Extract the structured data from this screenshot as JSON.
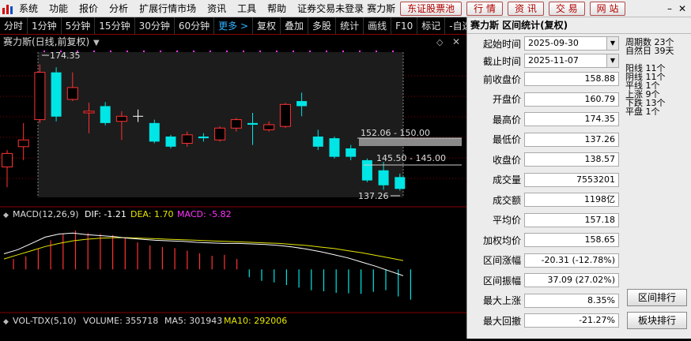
{
  "menu": {
    "items": [
      "系统",
      "功能",
      "报价",
      "分析",
      "扩展行情市场",
      "资讯",
      "工具",
      "帮助"
    ],
    "status": "证券交易未登录",
    "stock_name": "赛力斯",
    "buttons": [
      "东证股票池",
      "行 情",
      "资 讯",
      "交 易",
      "网 站"
    ]
  },
  "toolbar": {
    "items": [
      "分时",
      "1分钟",
      "5分钟",
      "15分钟",
      "30分钟",
      "60分钟"
    ],
    "more": "更多 >",
    "actions": [
      "复权",
      "叠加",
      "多股",
      "统计",
      "画线",
      "F10",
      "标记",
      "-自选"
    ]
  },
  "chart": {
    "title": "赛力斯(日线,前复权)",
    "high_label": "174.35",
    "low_label": "137.26",
    "range_labels": [
      "152.06 - 150.00",
      "145.50 - 145.00"
    ],
    "macd_label": "MACD(12,26,9)",
    "dif": "DIF: -1.21",
    "dea": "DEA: 1.70",
    "macd": "MACD: -5.82",
    "vol_label": "VOL-TDX(5,10)",
    "volume": "VOLUME: 355718",
    "ma5": "MA5: 301943",
    "ma10": "MA10: 292006",
    "colors": {
      "up": "#ff3232",
      "down": "#00e5e5",
      "dif": "#ffffff",
      "dea": "#e6e600",
      "macd": "#ff33ff",
      "grid": "#8a0000"
    }
  },
  "chart_data": {
    "type": "candlestick",
    "candles": [
      {
        "o": 144.0,
        "c": 148.0,
        "h": 149.0,
        "l": 138.0
      },
      {
        "o": 150.0,
        "c": 152.0,
        "h": 157.0,
        "l": 146.0
      },
      {
        "o": 158.0,
        "c": 172.0,
        "h": 174.35,
        "l": 157.0
      },
      {
        "o": 172.0,
        "c": 158.9,
        "h": 173.5,
        "l": 157.5
      },
      {
        "o": 164.0,
        "c": 167.5,
        "h": 172.0,
        "l": 163.5
      },
      {
        "o": 160.0,
        "c": 160.5,
        "h": 163.0,
        "l": 154.0
      },
      {
        "o": 162.0,
        "c": 157.0,
        "h": 163.2,
        "l": 156.3
      },
      {
        "o": 157.5,
        "c": 159.0,
        "h": 160.5,
        "l": 152.0
      },
      {
        "o": 159.0,
        "c": 159.0,
        "h": 161.0,
        "l": 157.3
      },
      {
        "o": 157.0,
        "c": 151.5,
        "h": 158.0,
        "l": 151.0
      },
      {
        "o": 153.0,
        "c": 150.0,
        "h": 153.5,
        "l": 149.5
      },
      {
        "o": 151.0,
        "c": 153.5,
        "h": 154.5,
        "l": 150.0
      },
      {
        "o": 153.0,
        "c": 152.5,
        "h": 154.0,
        "l": 151.5
      },
      {
        "o": 152.0,
        "c": 155.5,
        "h": 156.0,
        "l": 151.5
      },
      {
        "o": 155.5,
        "c": 158.0,
        "h": 158.5,
        "l": 154.5
      },
      {
        "o": 157.0,
        "c": 156.5,
        "h": 160.0,
        "l": 150.5
      },
      {
        "o": 155.0,
        "c": 156.5,
        "h": 157.5,
        "l": 154.5
      },
      {
        "o": 156.0,
        "c": 162.5,
        "h": 163.0,
        "l": 155.5
      },
      {
        "o": 163.5,
        "c": 162.0,
        "h": 166.0,
        "l": 159.0
      },
      {
        "o": 153.0,
        "c": 150.0,
        "h": 155.0,
        "l": 149.0
      },
      {
        "o": 152.5,
        "c": 147.0,
        "h": 153.0,
        "l": 146.5
      },
      {
        "o": 149.5,
        "c": 147.0,
        "h": 150.5,
        "l": 146.0
      },
      {
        "o": 146.0,
        "c": 140.0,
        "h": 146.5,
        "l": 139.5
      },
      {
        "o": 143.0,
        "c": 138.57,
        "h": 145.5,
        "l": 137.26
      },
      {
        "o": 141.0,
        "c": 137.5,
        "h": 142.0,
        "l": 137.0
      }
    ],
    "macd_hist": [
      2.0,
      2.5,
      4.0,
      5.6,
      6.8,
      7.5,
      7.0,
      6.8,
      6.6,
      6.0,
      5.2,
      4.6,
      4.3,
      4.1,
      3.6,
      3.1,
      2.6,
      2.8,
      2.0,
      -1.5,
      -2.2,
      -2.5,
      -3.0,
      -3.5,
      -4.0,
      -4.2,
      -4.5,
      -4.6,
      -4.7,
      -4.3,
      -4.0,
      -5.2,
      -5.82
    ],
    "dif_line": [
      3.0,
      3.8,
      5.0,
      6.2,
      6.8,
      7.0,
      6.7,
      6.5,
      6.3,
      6.0,
      5.8,
      5.6,
      5.5,
      5.4,
      5.2,
      5.1,
      5.0,
      5.0,
      4.9,
      4.8,
      4.6,
      4.3,
      3.9,
      3.4,
      2.8,
      2.2,
      1.4,
      0.6,
      -0.3,
      -1.21
    ],
    "dea_line": [
      2.0,
      2.8,
      3.6,
      4.4,
      5.0,
      5.5,
      5.8,
      6.0,
      6.1,
      6.1,
      6.0,
      5.9,
      5.8,
      5.7,
      5.6,
      5.5,
      5.4,
      5.3,
      5.2,
      5.1,
      5.0,
      4.8,
      4.6,
      4.3,
      4.0,
      3.6,
      3.2,
      2.7,
      2.2,
      1.7
    ],
    "ylim": [
      135,
      178
    ],
    "macd_range": [
      -8,
      9
    ]
  },
  "panel": {
    "title": "赛力斯 区间统计(复权)",
    "start_label": "起始时间",
    "start_date": "2025-09-30",
    "end_label": "截止时间",
    "end_date": "2025-11-07",
    "rows": [
      {
        "label": "前收盘价",
        "value": "158.88"
      },
      {
        "label": "开盘价",
        "value": "160.79"
      },
      {
        "label": "最高价",
        "value": "174.35"
      },
      {
        "label": "最低价",
        "value": "137.26"
      },
      {
        "label": "收盘价",
        "value": "138.57"
      },
      {
        "label": "成交量",
        "value": "7553201"
      },
      {
        "label": "成交额",
        "value": "1198亿"
      },
      {
        "label": "平均价",
        "value": "157.18"
      },
      {
        "label": "加权均价",
        "value": "158.65"
      },
      {
        "label": "区间涨幅",
        "value": "-20.31 (-12.78%)"
      },
      {
        "label": "区间振幅",
        "value": "37.09 (27.02%)"
      },
      {
        "label": "最大上涨",
        "value": "8.35%"
      },
      {
        "label": "最大回撤",
        "value": "-21.27%"
      }
    ],
    "stats": [
      "周期数 23个",
      "自然日 39天",
      "阳线 11个",
      "阴线 11个",
      "平线 1个",
      "上涨 9个",
      "下跌 13个",
      "平盘 1个"
    ],
    "btn_rank": "区间排行",
    "btn_sector": "板块排行"
  }
}
